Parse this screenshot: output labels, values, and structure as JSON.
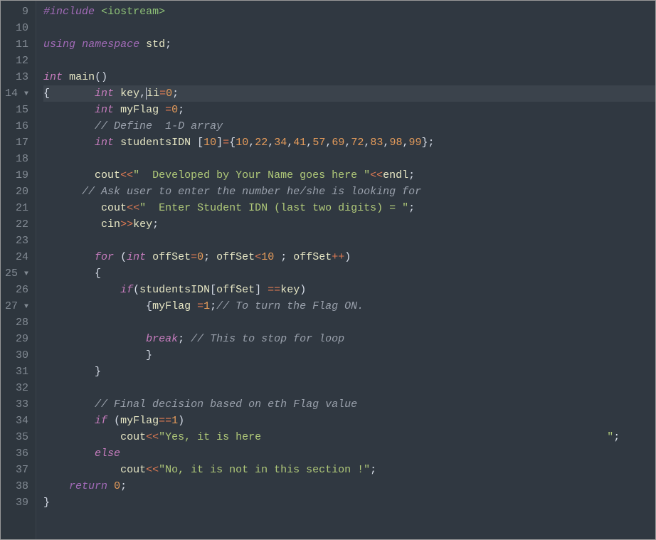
{
  "editor": {
    "first_line": 9,
    "line_count": 31,
    "highlight_line": 14,
    "tokens": [
      [
        [
          "kw1",
          "#include"
        ],
        [
          "pn",
          " "
        ],
        [
          "inc",
          "<iostream>"
        ]
      ],
      [],
      [
        [
          "kw1",
          "using"
        ],
        [
          "pn",
          " "
        ],
        [
          "kw1",
          "namespace"
        ],
        [
          "pn",
          " "
        ],
        [
          "id",
          "std"
        ],
        [
          "pn",
          ";"
        ]
      ],
      [],
      [
        [
          "kw2",
          "int"
        ],
        [
          "pn",
          " "
        ],
        [
          "id",
          "main"
        ],
        [
          "pn",
          "()"
        ]
      ],
      [
        [
          "pn",
          "{       "
        ],
        [
          "kw2",
          "int"
        ],
        [
          "pn",
          " "
        ],
        [
          "id",
          "key"
        ],
        [
          "pn",
          ","
        ],
        [
          "id",
          "ii"
        ],
        [
          "op",
          "="
        ],
        [
          "num",
          "0"
        ],
        [
          "pn",
          ";"
        ]
      ],
      [
        [
          "pn",
          "        "
        ],
        [
          "kw2",
          "int"
        ],
        [
          "pn",
          " "
        ],
        [
          "id",
          "myFlag"
        ],
        [
          "pn",
          " "
        ],
        [
          "op",
          "="
        ],
        [
          "num",
          "0"
        ],
        [
          "pn",
          ";"
        ]
      ],
      [
        [
          "pn",
          "        "
        ],
        [
          "cmt",
          "// Define  1-D array"
        ]
      ],
      [
        [
          "pn",
          "        "
        ],
        [
          "kw2",
          "int"
        ],
        [
          "pn",
          " "
        ],
        [
          "id",
          "studentsIDN"
        ],
        [
          "pn",
          " ["
        ],
        [
          "num",
          "10"
        ],
        [
          "pn",
          "]"
        ],
        [
          "op",
          "="
        ],
        [
          "pn",
          "{"
        ],
        [
          "num",
          "10"
        ],
        [
          "pn",
          ","
        ],
        [
          "num",
          "22"
        ],
        [
          "pn",
          ","
        ],
        [
          "num",
          "34"
        ],
        [
          "pn",
          ","
        ],
        [
          "num",
          "41"
        ],
        [
          "pn",
          ","
        ],
        [
          "num",
          "57"
        ],
        [
          "pn",
          ","
        ],
        [
          "num",
          "69"
        ],
        [
          "pn",
          ","
        ],
        [
          "num",
          "72"
        ],
        [
          "pn",
          ","
        ],
        [
          "num",
          "83"
        ],
        [
          "pn",
          ","
        ],
        [
          "num",
          "98"
        ],
        [
          "pn",
          ","
        ],
        [
          "num",
          "99"
        ],
        [
          "pn",
          "};"
        ]
      ],
      [],
      [
        [
          "pn",
          "        "
        ],
        [
          "id",
          "cout"
        ],
        [
          "op",
          "<<"
        ],
        [
          "str",
          "\"  Developed by Your Name goes here \""
        ],
        [
          "op",
          "<<"
        ],
        [
          "id",
          "endl"
        ],
        [
          "pn",
          ";"
        ]
      ],
      [
        [
          "pn",
          "      "
        ],
        [
          "cmt",
          "// Ask user to enter the number he/she is looking for"
        ]
      ],
      [
        [
          "pn",
          "         "
        ],
        [
          "id",
          "cout"
        ],
        [
          "op",
          "<<"
        ],
        [
          "str",
          "\"  Enter Student IDN (last two digits) = \""
        ],
        [
          "pn",
          ";"
        ]
      ],
      [
        [
          "pn",
          "         "
        ],
        [
          "id",
          "cin"
        ],
        [
          "op",
          ">>"
        ],
        [
          "id",
          "key"
        ],
        [
          "pn",
          ";"
        ]
      ],
      [],
      [
        [
          "pn",
          "        "
        ],
        [
          "kw3",
          "for"
        ],
        [
          "pn",
          " ("
        ],
        [
          "kw2",
          "int"
        ],
        [
          "pn",
          " "
        ],
        [
          "id",
          "offSet"
        ],
        [
          "op",
          "="
        ],
        [
          "num",
          "0"
        ],
        [
          "pn",
          "; "
        ],
        [
          "id",
          "offSet"
        ],
        [
          "op",
          "<"
        ],
        [
          "num",
          "10"
        ],
        [
          "pn",
          " ; "
        ],
        [
          "id",
          "offSet"
        ],
        [
          "op",
          "++"
        ],
        [
          "pn",
          ")"
        ]
      ],
      [
        [
          "pn",
          "        {"
        ]
      ],
      [
        [
          "pn",
          "            "
        ],
        [
          "kw3",
          "if"
        ],
        [
          "pn",
          "("
        ],
        [
          "id",
          "studentsIDN"
        ],
        [
          "pn",
          "["
        ],
        [
          "id",
          "offSet"
        ],
        [
          "pn",
          "] "
        ],
        [
          "op",
          "=="
        ],
        [
          "id",
          "key"
        ],
        [
          "pn",
          ")"
        ]
      ],
      [
        [
          "pn",
          "                {"
        ],
        [
          "id",
          "myFlag"
        ],
        [
          "pn",
          " "
        ],
        [
          "op",
          "="
        ],
        [
          "num",
          "1"
        ],
        [
          "pn",
          ";"
        ],
        [
          "cmt",
          "// To turn the Flag ON."
        ]
      ],
      [],
      [
        [
          "pn",
          "                "
        ],
        [
          "kw3",
          "break"
        ],
        [
          "pn",
          "; "
        ],
        [
          "cmt",
          "// This to stop for loop"
        ]
      ],
      [
        [
          "pn",
          "                }"
        ]
      ],
      [
        [
          "pn",
          "        }"
        ]
      ],
      [],
      [
        [
          "pn",
          "        "
        ],
        [
          "cmt",
          "// Final decision based on eth Flag value"
        ]
      ],
      [
        [
          "pn",
          "        "
        ],
        [
          "kw3",
          "if"
        ],
        [
          "pn",
          " ("
        ],
        [
          "id",
          "myFlag"
        ],
        [
          "op",
          "=="
        ],
        [
          "num",
          "1"
        ],
        [
          "pn",
          ")"
        ]
      ],
      [
        [
          "pn",
          "            "
        ],
        [
          "id",
          "cout"
        ],
        [
          "op",
          "<<"
        ],
        [
          "str",
          "\"Yes, it is here                                                      \""
        ],
        [
          "pn",
          ";"
        ]
      ],
      [
        [
          "pn",
          "        "
        ],
        [
          "kw3",
          "else"
        ]
      ],
      [
        [
          "pn",
          "            "
        ],
        [
          "id",
          "cout"
        ],
        [
          "op",
          "<<"
        ],
        [
          "str",
          "\"No, it is not in this section !\""
        ],
        [
          "pn",
          ";"
        ]
      ],
      [
        [
          "pn",
          "    "
        ],
        [
          "kw1",
          "return"
        ],
        [
          "pn",
          " "
        ],
        [
          "num",
          "0"
        ],
        [
          "pn",
          ";"
        ]
      ],
      [
        [
          "pn",
          "}"
        ]
      ]
    ],
    "fold_lines": [
      14,
      25,
      27
    ]
  }
}
